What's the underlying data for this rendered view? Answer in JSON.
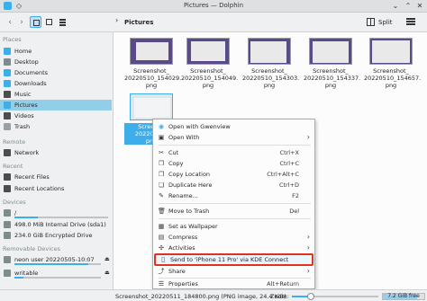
{
  "window": {
    "title": "Pictures — Dolphin"
  },
  "toolbar": {
    "breadcrumb": "Pictures",
    "split_label": "Split"
  },
  "sidebar": {
    "places_header": "Places",
    "places": [
      "Home",
      "Desktop",
      "Documents",
      "Downloads",
      "Music",
      "Pictures",
      "Videos",
      "Trash"
    ],
    "remote_header": "Remote",
    "remote": [
      "Network"
    ],
    "recent_header": "Recent",
    "recent": [
      "Recent Files",
      "Recent Locations"
    ],
    "devices_header": "Devices",
    "devices": [
      {
        "label": "/",
        "usage": 0.25
      },
      {
        "label": "498.0 MiB Internal Drive (sda1)"
      },
      {
        "label": "234.0 GiB Encrypted Drive"
      }
    ],
    "removable_header": "Removable Devices",
    "removable": [
      {
        "label": "neon user 20220505-10:07",
        "usage": 0.85
      },
      {
        "label": "writable",
        "usage": 0.1
      }
    ]
  },
  "files": [
    {
      "line1": "Screenshot_",
      "line2": "20220510_154029.",
      "line3": "png"
    },
    {
      "line1": "Screenshot_",
      "line2": "20220510_154049.",
      "line3": "png"
    },
    {
      "line1": "Screenshot_",
      "line2": "20220510_154303.",
      "line3": "png"
    },
    {
      "line1": "Screenshot_",
      "line2": "20220510_154337.",
      "line3": "png"
    },
    {
      "line1": "Screenshot_",
      "line2": "20220510_154657.",
      "line3": "png"
    },
    {
      "line1": "Screensh",
      "line2": "20220511_",
      "line3": "png"
    }
  ],
  "context_menu": {
    "items": [
      {
        "label": "Open with Gwenview",
        "icon": "gwenview-icon"
      },
      {
        "label": "Open With",
        "icon": "open-with-icon",
        "submenu": true
      },
      {
        "label": "Cut",
        "shortcut": "Ctrl+X",
        "icon": "cut-icon"
      },
      {
        "label": "Copy",
        "shortcut": "Ctrl+C",
        "icon": "copy-icon"
      },
      {
        "label": "Copy Location",
        "shortcut": "Ctrl+Alt+C",
        "icon": "copy-location-icon"
      },
      {
        "label": "Duplicate Here",
        "shortcut": "Ctrl+D",
        "icon": "duplicate-icon"
      },
      {
        "label": "Rename...",
        "shortcut": "F2",
        "icon": "rename-icon"
      },
      {
        "label": "Move to Trash",
        "shortcut": "Del",
        "icon": "trash-icon"
      },
      {
        "label": "Set as Wallpaper",
        "icon": "wallpaper-icon"
      },
      {
        "label": "Compress",
        "icon": "compress-icon",
        "submenu": true
      },
      {
        "label": "Activities",
        "icon": "activities-icon",
        "submenu": true
      },
      {
        "label": "Send to 'iPhone 11 Pro' via KDE Connect",
        "icon": "kdeconnect-icon"
      },
      {
        "label": "Share",
        "icon": "share-icon",
        "submenu": true
      },
      {
        "label": "Properties",
        "shortcut": "Alt+Return",
        "icon": "properties-icon"
      }
    ]
  },
  "statusbar": {
    "text": "Screenshot_20220511_184800.png (PNG image, 24.4 KiB)",
    "zoom_label": "Zoom:",
    "zoom_level": 0.22,
    "free_space": "7.2 GiB free",
    "used_fraction": 0.82
  },
  "colors": {
    "accent": "#3daee9",
    "highlight_border": "#e0321e",
    "selection": "#93cee9"
  }
}
